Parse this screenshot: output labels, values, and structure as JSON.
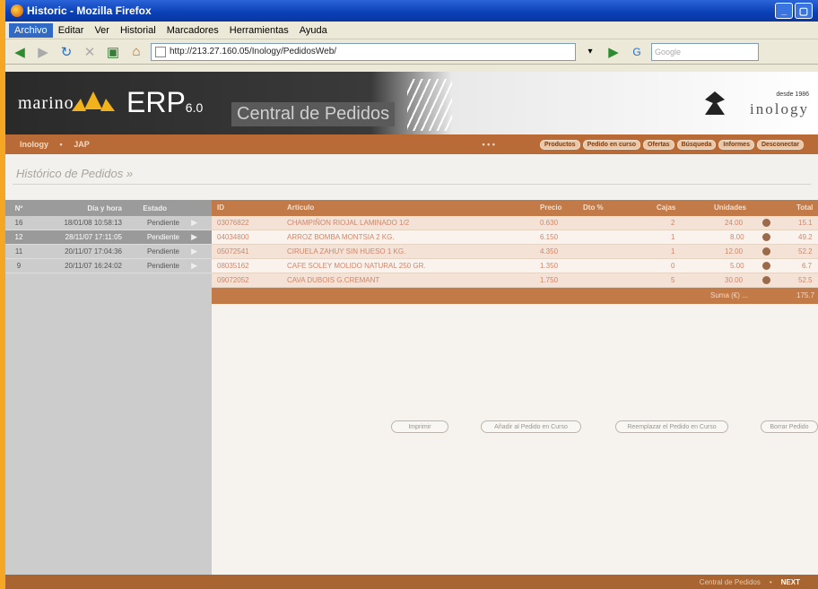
{
  "window": {
    "title": "Historic - Mozilla Firefox"
  },
  "menu": [
    "Archivo",
    "Editar",
    "Ver",
    "Historial",
    "Marcadores",
    "Herramientas",
    "Ayuda"
  ],
  "toolbar": {
    "url": "http://213.27.160.05/Inology/PedidosWeb/",
    "search_placeholder": "Google"
  },
  "banner": {
    "brand": "marino",
    "erp": "ERP",
    "erp_version": "6.0",
    "central": "Central de Pedidos",
    "desde": "desde 1986",
    "company": "inology"
  },
  "nav": {
    "crumbs": [
      "Inology",
      "•",
      "JAP"
    ],
    "dots": "• • •",
    "tabs": [
      "Productos",
      "Pedido en curso",
      "Ofertas",
      "Búsqueda",
      "Informes",
      "Desconectar"
    ]
  },
  "page_title": "Histórico de Pedidos »",
  "left_table": {
    "headers": {
      "num": "Nº",
      "date": "Día y hora",
      "status": "Estado"
    },
    "rows": [
      {
        "num": "16",
        "date": "18/01/08 10:58:13",
        "status": "Pendiente"
      },
      {
        "num": "12",
        "date": "28/11/07 17:11:05",
        "status": "Pendiente"
      },
      {
        "num": "11",
        "date": "20/11/07 17:04:36",
        "status": "Pendiente"
      },
      {
        "num": "9",
        "date": "20/11/07 16:24:02",
        "status": "Pendiente"
      }
    ]
  },
  "right_table": {
    "headers": {
      "id": "ID",
      "article": "Artículo",
      "price": "Precio",
      "discount": "Dto %",
      "boxes": "Cajas",
      "units": "Unidades",
      "total": "Total"
    },
    "rows": [
      {
        "id": "03076822",
        "article": "CHAMPIÑON RIOJAL LAMINADO 1/2",
        "price": "0.630",
        "boxes": "2",
        "units": "24.00",
        "total": "15.1"
      },
      {
        "id": "04034800",
        "article": "ARROZ BOMBA MONTSIA 2 KG.",
        "price": "6.150",
        "boxes": "1",
        "units": "8.00",
        "total": "49.2"
      },
      {
        "id": "05072541",
        "article": "CIRUELA ZAHUY SIN HUESO 1 KG.",
        "price": "4.350",
        "boxes": "1",
        "units": "12.00",
        "total": "52.2"
      },
      {
        "id": "08035162",
        "article": "CAFE SOLEY MOLIDO NATURAL 250 GR.",
        "price": "1.350",
        "boxes": "0",
        "units": "5.00",
        "total": "6.7"
      },
      {
        "id": "09072052",
        "article": "CAVA DUBOIS G.CREMANT",
        "price": "1.750",
        "boxes": "5",
        "units": "30.00",
        "total": "52.5"
      }
    ],
    "total_label": "Suma (€) ...",
    "total_value": "175.7"
  },
  "actions": [
    "Imprimir",
    "Añadir al Pedido en Curso",
    "Reemplazar el Pedido en Curso",
    "Borrar Pedido"
  ],
  "footer": {
    "label": "Central de Pedidos",
    "sep": "•",
    "brand": "NEXT"
  }
}
